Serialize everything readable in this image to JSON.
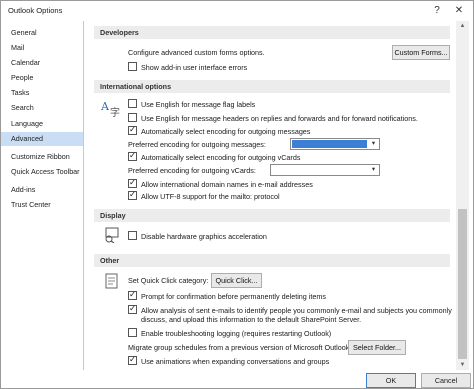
{
  "window": {
    "title": "Outlook Options",
    "help_glyph": "?",
    "close_glyph": "✕"
  },
  "sidebar": {
    "items": [
      {
        "label": "General"
      },
      {
        "label": "Mail"
      },
      {
        "label": "Calendar"
      },
      {
        "label": "People"
      },
      {
        "label": "Tasks"
      },
      {
        "label": "Search"
      },
      {
        "label": "Language"
      },
      {
        "label": "Advanced",
        "selected": true
      },
      {
        "label": "Customize Ribbon"
      },
      {
        "label": "Quick Access Toolbar"
      },
      {
        "label": "Add-ins"
      },
      {
        "label": "Trust Center"
      }
    ]
  },
  "developers": {
    "header": "Developers",
    "configure_label": "Configure advanced custom forms options.",
    "custom_forms_button": "Custom Forms...",
    "show_addin_errors": {
      "label": "Show add-in user interface errors",
      "checked": false
    }
  },
  "international": {
    "header": "International options",
    "english_flag_labels": {
      "label": "Use English for message flag labels",
      "checked": false
    },
    "english_headers": {
      "label": "Use English for message headers on replies and forwards and for forward notifications.",
      "checked": false
    },
    "auto_encoding_outgoing": {
      "label": "Automatically select encoding for outgoing messages",
      "checked": true
    },
    "preferred_outgoing_label": "Preferred encoding for outgoing messages:",
    "auto_encoding_vcards": {
      "label": "Automatically select encoding for outgoing vCards",
      "checked": true
    },
    "preferred_vcards_label": "Preferred encoding for outgoing vCards:",
    "intl_domain_names": {
      "label": "Allow international domain names in e-mail addresses",
      "checked": true
    },
    "utf8_mailto": {
      "label": "Allow UTF-8 support for the mailto: protocol",
      "checked": true
    }
  },
  "display": {
    "header": "Display",
    "disable_hw_accel": {
      "label": "Disable hardware graphics acceleration",
      "checked": false
    }
  },
  "other": {
    "header": "Other",
    "quick_click_label": "Set Quick Click category:",
    "quick_click_button": "Quick Click...",
    "prompt_delete": {
      "label": "Prompt for confirmation before permanently deleting items",
      "checked": true
    },
    "analysis_line1": "Allow analysis of sent e-mails to identify people you commonly e-mail and subjects you commonly",
    "analysis_line2": "discuss, and upload this information to the default SharePoint Server.",
    "analysis_checked": true,
    "troubleshooting_logging": {
      "label": "Enable troubleshooting logging (requires restarting Outlook)",
      "checked": false
    },
    "migrate_label": "Migrate group schedules from a previous version of Microsoft Outlook:",
    "select_folder_button": "Select Folder...",
    "animations": {
      "label": "Use animations when expanding conversations and groups",
      "checked": true
    }
  },
  "footer": {
    "ok_label": "OK",
    "cancel_label": "Cancel"
  },
  "colors": {
    "accent": "#3c7fd6",
    "selected_nav": "#c9def5",
    "section_header_bg": "#ececec"
  }
}
